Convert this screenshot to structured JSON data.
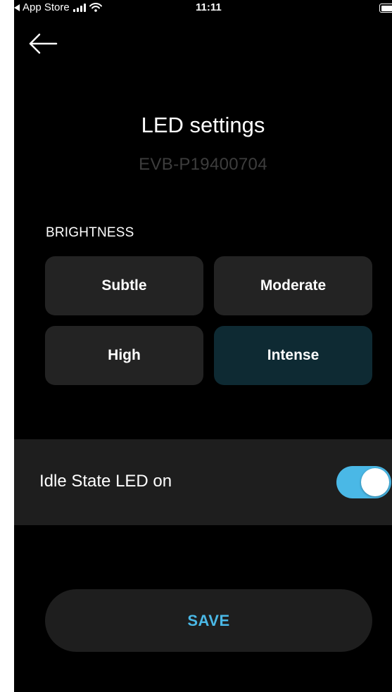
{
  "status_bar": {
    "back_app": "App Store",
    "time": "11:11"
  },
  "header": {
    "title": "LED settings",
    "serial": "EVB-P19400704",
    "back_icon": "arrow-left-icon"
  },
  "brightness": {
    "label": "BRIGHTNESS",
    "options": [
      {
        "label": "Subtle",
        "selected": false
      },
      {
        "label": "Moderate",
        "selected": false
      },
      {
        "label": "High",
        "selected": false
      },
      {
        "label": "Intense",
        "selected": true
      }
    ]
  },
  "idle_led": {
    "label": "Idle State LED on",
    "enabled": true
  },
  "save": {
    "label": "SAVE"
  },
  "colors": {
    "background": "#000000",
    "card": "#232323",
    "selected_card": "#0e2a33",
    "accent": "#4ab8e6",
    "serial_text": "#3d3d3d"
  }
}
